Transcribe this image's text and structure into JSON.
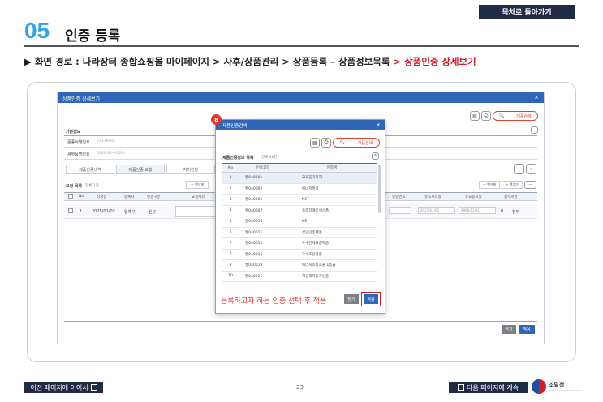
{
  "header": {
    "toc_button": "목차로 돌아가기",
    "section_number": "05",
    "section_title": "인증 등록",
    "path_prefix": "▶ 화면 경로 : ",
    "path_normal": "나라장터 종합쇼핑몰 마이페이지 > 사후/상품관리 > 상품등록 – 상품정보목록 ",
    "path_highlight": "> 상품인증 상세보기"
  },
  "app": {
    "title": "상품인증 상세보기",
    "close": "×",
    "search_label": "재품검색",
    "section_basic": "기본정보",
    "field1_label": "품종식별번호",
    "field1_value": "21376684",
    "field2_label": "세부품명번호",
    "field2_value": "5000-81-00000",
    "tabs": [
      "제품인증내역",
      "제품인증 요청",
      "처리현황"
    ],
    "list_title": "요청 목록",
    "list_count": "전체 1건",
    "add_row": "— 행삭제",
    "add_row2": "+ 행추가",
    "add_row3": "— 행삭제",
    "columns": [
      "No",
      "작성일",
      "등록자",
      "변경구분",
      "요청사유",
      "인증번호",
      "유효시작일",
      "유효종료일",
      "첨부파일"
    ],
    "row": {
      "no": "1",
      "date": "2025/01/03",
      "user": "업체구",
      "type": "신규",
      "start": "2025/01/03",
      "end": "9999/12/31",
      "file_count": "0",
      "file_label": "첨부"
    },
    "bottom_cancel": "닫기",
    "bottom_apply": "적용"
  },
  "modal": {
    "badge": "8",
    "title": "제품인증검색",
    "close": "×",
    "search_label": "재품검색",
    "list_title": "제품인증정보 목록",
    "list_count": "전체 40건",
    "columns": [
      "No",
      "인증코드",
      "인증명"
    ],
    "rows": [
      {
        "no": "1",
        "code": "월040001",
        "name": "고효율기자재"
      },
      {
        "no": "2",
        "code": "월040002",
        "name": "에너지절약"
      },
      {
        "no": "3",
        "code": "월040006",
        "name": "NET"
      },
      {
        "no": "4",
        "code": "월040007",
        "name": "중증장애인생산품"
      },
      {
        "no": "5",
        "code": "월040010",
        "name": "KS"
      },
      {
        "no": "6",
        "code": "월040011",
        "name": "성능인증제품"
      },
      {
        "no": "7",
        "code": "월040012",
        "name": "우수단체표준제품"
      },
      {
        "no": "8",
        "code": "월040016",
        "name": "우수조달물품"
      },
      {
        "no": "9",
        "code": "월040019",
        "name": "에너지소비효율 1등급"
      },
      {
        "no": "10",
        "code": "월040021",
        "name": "저공해자동차인증"
      }
    ],
    "instruction": "등록하고자 하는 인증 선택 후 적용",
    "cancel": "닫기",
    "apply": "적용"
  },
  "footer": {
    "prev": "이전 페이지에 이어서",
    "next": "다음 페이지에 계속",
    "page": "23",
    "logo_text": "조달청",
    "logo_sub": "Public Procurement Service",
    "prev_icon": "minus-square-icon",
    "next_icon": "minus-square-icon"
  }
}
